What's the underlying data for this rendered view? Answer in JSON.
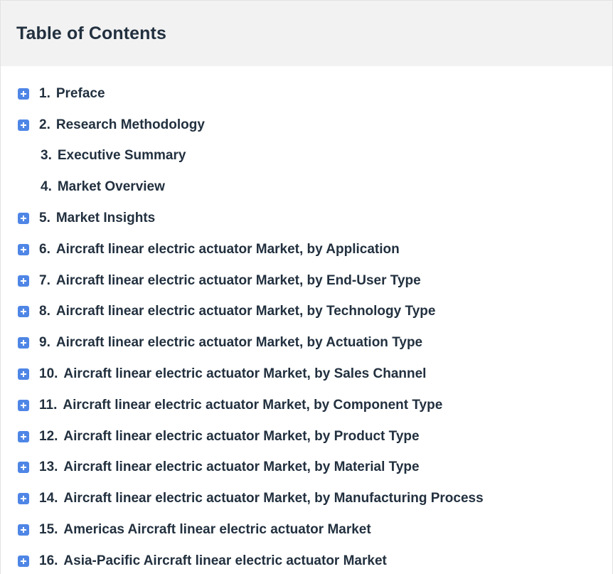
{
  "header": {
    "title": "Table of Contents"
  },
  "icons": {
    "expand": "plus-square-icon",
    "accent_color": "#4f86e6"
  },
  "toc": {
    "items": [
      {
        "num": "1.",
        "label": "Preface",
        "expandable": true
      },
      {
        "num": "2.",
        "label": "Research Methodology",
        "expandable": true
      },
      {
        "num": "3.",
        "label": "Executive Summary",
        "expandable": false
      },
      {
        "num": "4.",
        "label": "Market Overview",
        "expandable": false
      },
      {
        "num": "5.",
        "label": "Market Insights",
        "expandable": true
      },
      {
        "num": "6.",
        "label": "Aircraft linear electric actuator Market, by Application",
        "expandable": true
      },
      {
        "num": "7.",
        "label": "Aircraft linear electric actuator Market, by End-User Type",
        "expandable": true
      },
      {
        "num": "8.",
        "label": "Aircraft linear electric actuator Market, by Technology Type",
        "expandable": true
      },
      {
        "num": "9.",
        "label": "Aircraft linear electric actuator Market, by Actuation Type",
        "expandable": true
      },
      {
        "num": "10.",
        "label": "Aircraft linear electric actuator Market, by Sales Channel",
        "expandable": true
      },
      {
        "num": "11.",
        "label": "Aircraft linear electric actuator Market, by Component Type",
        "expandable": true
      },
      {
        "num": "12.",
        "label": "Aircraft linear electric actuator Market, by Product Type",
        "expandable": true
      },
      {
        "num": "13.",
        "label": "Aircraft linear electric actuator Market, by Material Type",
        "expandable": true
      },
      {
        "num": "14.",
        "label": "Aircraft linear electric actuator Market, by Manufacturing Process",
        "expandable": true
      },
      {
        "num": "15.",
        "label": "Americas Aircraft linear electric actuator Market",
        "expandable": true
      },
      {
        "num": "16.",
        "label": "Asia-Pacific Aircraft linear electric actuator Market",
        "expandable": true
      }
    ]
  }
}
